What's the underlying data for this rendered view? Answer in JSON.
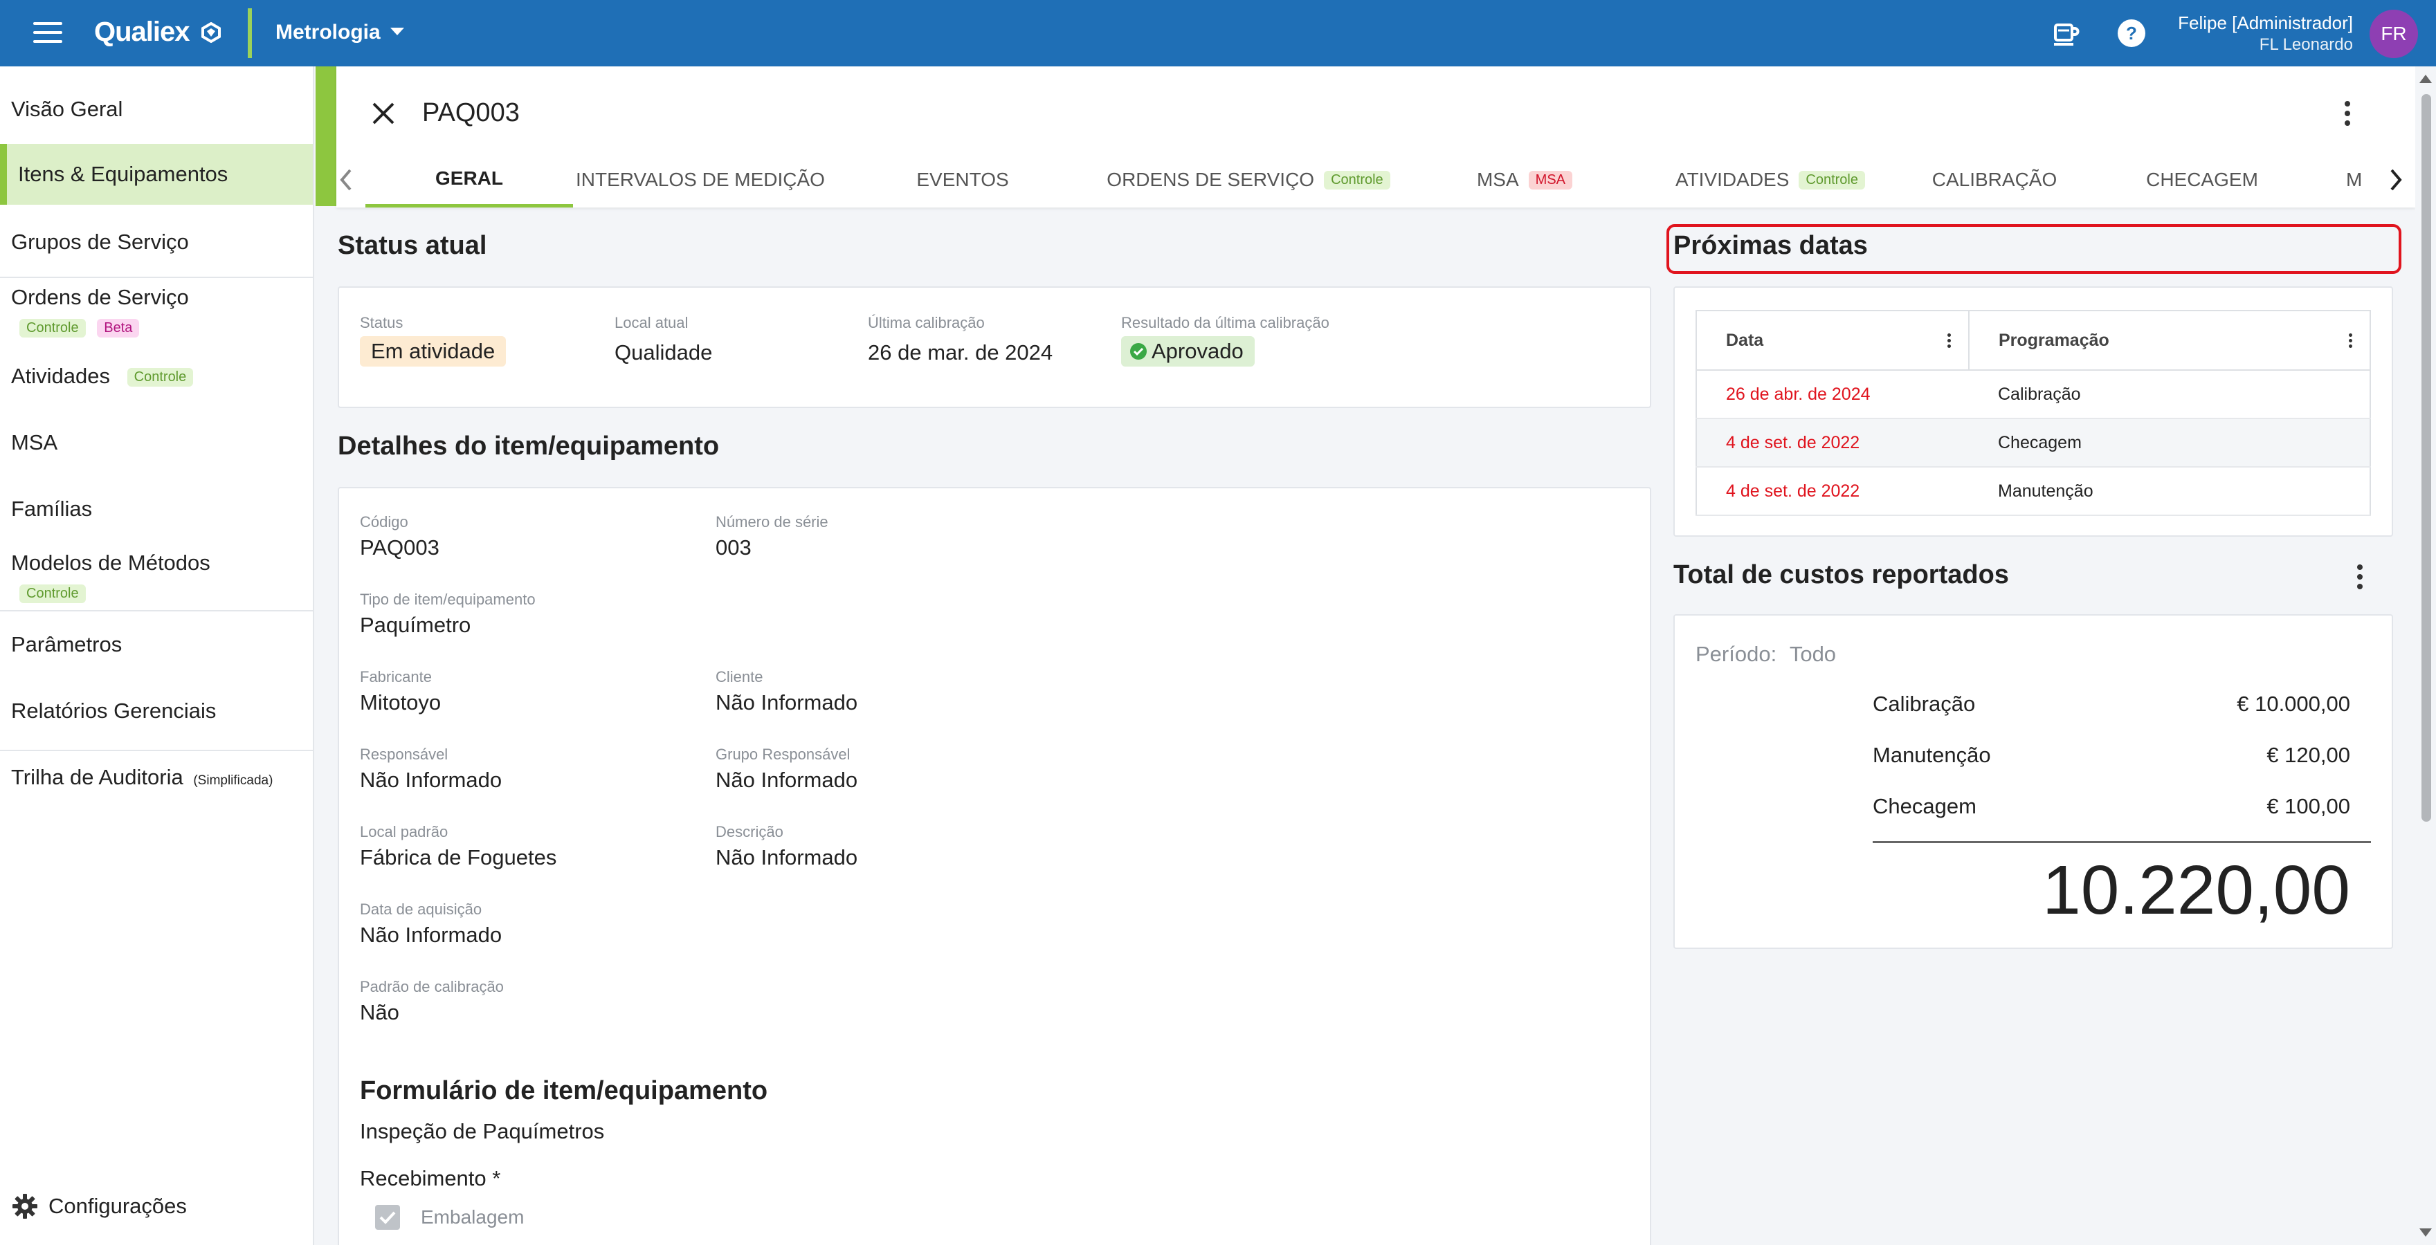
{
  "topbar": {
    "brand": "Qualiex",
    "module": "Metrologia",
    "user_name": "Felipe [Administrador]",
    "user_org": "FL Leonardo",
    "avatar_initials": "FR"
  },
  "sidebar": {
    "items": [
      {
        "label": "Visão Geral"
      },
      {
        "label": "Itens & Equipamentos"
      },
      {
        "label": "Grupos de Serviço"
      },
      {
        "label": "Ordens de Serviço",
        "badges": [
          "Controle",
          "Beta"
        ]
      },
      {
        "label": "Atividades",
        "badges": [
          "Controle"
        ]
      },
      {
        "label": "MSA"
      },
      {
        "label": "Famílias"
      },
      {
        "label": "Modelos de Métodos",
        "badges": [
          "Controle"
        ]
      },
      {
        "label": "Parâmetros"
      },
      {
        "label": "Relatórios Gerenciais"
      },
      {
        "label": "Trilha de Auditoria",
        "suffix": "(Simplificada)"
      }
    ],
    "settings_label": "Configurações"
  },
  "header": {
    "title": "PAQ003",
    "tabs": [
      {
        "label": "GERAL"
      },
      {
        "label": "INTERVALOS DE MEDIÇÃO"
      },
      {
        "label": "EVENTOS"
      },
      {
        "label": "ORDENS DE SERVIÇO",
        "badge": "Controle"
      },
      {
        "label": "MSA",
        "badge": "MSA"
      },
      {
        "label": "ATIVIDADES",
        "badge": "Controle"
      },
      {
        "label": "CALIBRAÇÃO"
      },
      {
        "label": "CHECAGEM"
      },
      {
        "label": "M"
      }
    ]
  },
  "status": {
    "title": "Status atual",
    "status_label": "Status",
    "status_value": "Em atividade",
    "local_label": "Local atual",
    "local_value": "Qualidade",
    "last_cal_label": "Última calibração",
    "last_cal_value": "26 de mar. de 2024",
    "result_label": "Resultado da última calibração",
    "result_value": "Aprovado"
  },
  "details": {
    "title": "Detalhes do item/equipamento",
    "fields": [
      {
        "label": "Código",
        "value": "PAQ003"
      },
      {
        "label": "Número de série",
        "value": "003"
      },
      {
        "label": "Tipo de item/equipamento",
        "value": "Paquímetro"
      },
      {
        "label": "Fabricante",
        "value": "Mitotoyo"
      },
      {
        "label": "Cliente",
        "value": "Não Informado"
      },
      {
        "label": "Responsável",
        "value": "Não Informado"
      },
      {
        "label": "Grupo Responsável",
        "value": "Não Informado"
      },
      {
        "label": "Local padrão",
        "value": "Fábrica de Foguetes"
      },
      {
        "label": "Descrição",
        "value": "Não Informado"
      },
      {
        "label": "Data de aquisição",
        "value": "Não Informado"
      },
      {
        "label": "Padrão de calibração",
        "value": "Não"
      }
    ]
  },
  "form": {
    "title": "Formulário de item/equipamento",
    "name": "Inspeção de Paquímetros",
    "section": "Recebimento *",
    "checkbox_label": "Embalagem"
  },
  "next_dates": {
    "title": "Próximas datas",
    "columns": [
      "Data",
      "Programação"
    ],
    "rows": [
      [
        "26 de abr. de 2024",
        "Calibração"
      ],
      [
        "4 de set. de 2022",
        "Checagem"
      ],
      [
        "4 de set. de 2022",
        "Manutenção"
      ]
    ]
  },
  "costs": {
    "title": "Total de custos reportados",
    "period_label": "Período:",
    "period_value": "Todo",
    "items": [
      {
        "label": "Calibração",
        "value": "€ 10.000,00"
      },
      {
        "label": "Manutenção",
        "value": "€ 120,00"
      },
      {
        "label": "Checagem",
        "value": "€ 100,00"
      }
    ],
    "total": "10.220,00"
  },
  "colors": {
    "topbar": "#1f6fb6",
    "accent_green": "#8dc63f",
    "alert_red": "#e0141e",
    "avatar": "#8e3fb3"
  }
}
